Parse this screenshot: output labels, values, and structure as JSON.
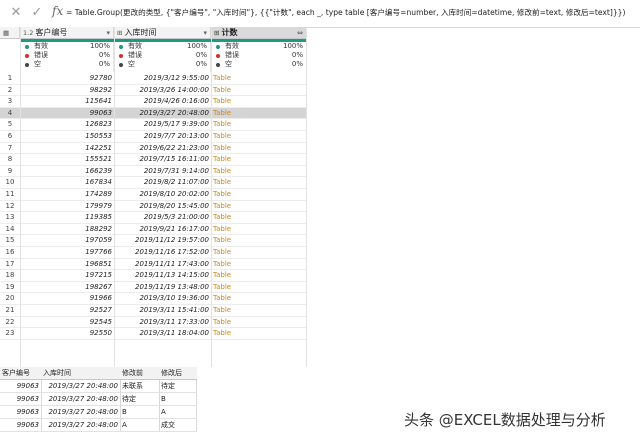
{
  "formula_bar": {
    "cancel_icon": "close-icon",
    "confirm_icon": "check-icon",
    "fx_label": "fx",
    "formula": "= Table.Group(更改的类型, {\"客户编号\", \"入库时间\"}, {{\"计数\", each _, type table [客户编号=number, 入库时间=datetime, 修改前=text, 修改后=text]}})"
  },
  "columns": [
    {
      "type_icon": "1.2",
      "name": "客户编号"
    },
    {
      "type_icon": "⊞",
      "name": "入库时间"
    },
    {
      "type_icon": "⊞",
      "name": "计数",
      "expand_icon": "⇔"
    }
  ],
  "column_quality": {
    "labels": [
      "有效",
      "错误",
      "空"
    ],
    "colors": [
      "#1d9a82",
      "#d0312d",
      "#444444"
    ],
    "values": [
      [
        "100%",
        "0%",
        "0%"
      ],
      [
        "100%",
        "0%",
        "0%"
      ],
      [
        "100%",
        "0%",
        "0%"
      ]
    ]
  },
  "rows": [
    {
      "n": "1",
      "id": "92780",
      "time": "2019/3/12 9:55:00",
      "count": "Table"
    },
    {
      "n": "2",
      "id": "98292",
      "time": "2019/3/26 14:00:00",
      "count": "Table"
    },
    {
      "n": "3",
      "id": "115641",
      "time": "2019/4/26 0:16:00",
      "count": "Table"
    },
    {
      "n": "4",
      "id": "99063",
      "time": "2019/3/27 20:48:00",
      "count": "Table"
    },
    {
      "n": "5",
      "id": "126823",
      "time": "2019/5/17 9:39:00",
      "count": "Table"
    },
    {
      "n": "6",
      "id": "150553",
      "time": "2019/7/7 20:13:00",
      "count": "Table"
    },
    {
      "n": "7",
      "id": "142251",
      "time": "2019/6/22 21:23:00",
      "count": "Table"
    },
    {
      "n": "8",
      "id": "155521",
      "time": "2019/7/15 16:11:00",
      "count": "Table"
    },
    {
      "n": "9",
      "id": "166239",
      "time": "2019/7/31 9:14:00",
      "count": "Table"
    },
    {
      "n": "10",
      "id": "167834",
      "time": "2019/8/2 11:07:00",
      "count": "Table"
    },
    {
      "n": "11",
      "id": "174289",
      "time": "2019/8/10 20:02:00",
      "count": "Table"
    },
    {
      "n": "12",
      "id": "179979",
      "time": "2019/8/20 15:45:00",
      "count": "Table"
    },
    {
      "n": "13",
      "id": "119385",
      "time": "2019/5/3 21:00:00",
      "count": "Table"
    },
    {
      "n": "14",
      "id": "188292",
      "time": "2019/9/21 16:17:00",
      "count": "Table"
    },
    {
      "n": "15",
      "id": "197059",
      "time": "2019/11/12 19:57:00",
      "count": "Table"
    },
    {
      "n": "16",
      "id": "197766",
      "time": "2019/11/16 17:52:00",
      "count": "Table"
    },
    {
      "n": "17",
      "id": "196851",
      "time": "2019/11/11 17:43:00",
      "count": "Table"
    },
    {
      "n": "18",
      "id": "197215",
      "time": "2019/11/13 14:15:00",
      "count": "Table"
    },
    {
      "n": "19",
      "id": "198267",
      "time": "2019/11/19 13:48:00",
      "count": "Table"
    },
    {
      "n": "20",
      "id": "91966",
      "time": "2019/3/10 19:36:00",
      "count": "Table"
    },
    {
      "n": "21",
      "id": "92527",
      "time": "2019/3/11 15:41:00",
      "count": "Table"
    },
    {
      "n": "22",
      "id": "92545",
      "time": "2019/3/11 17:33:00",
      "count": "Table"
    },
    {
      "n": "23",
      "id": "92550",
      "time": "2019/3/11 18:04:00",
      "count": "Table"
    }
  ],
  "selected_row": 3,
  "nested_table": {
    "headers": [
      "客户编号",
      "入库时间",
      "修改前",
      "修改后"
    ],
    "rows": [
      [
        "99063",
        "2019/3/27 20:48:00",
        "未联系",
        "待定"
      ],
      [
        "99063",
        "2019/3/27 20:48:00",
        "待定",
        "B"
      ],
      [
        "99063",
        "2019/3/27 20:48:00",
        "B",
        "A"
      ],
      [
        "99063",
        "2019/3/27 20:48:00",
        "A",
        "成交"
      ]
    ]
  },
  "watermark": "头条 @EXCEL数据处理与分析"
}
